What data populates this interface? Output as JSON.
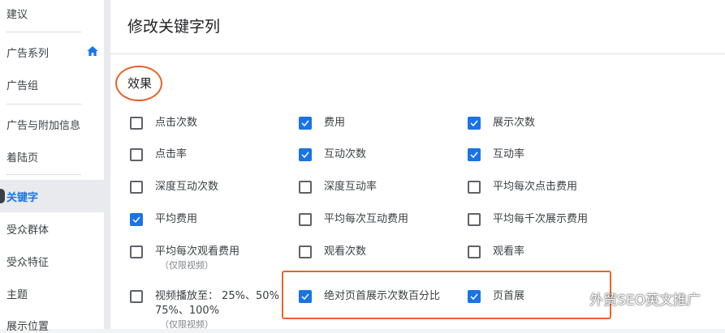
{
  "sidebar": {
    "items": [
      {
        "label": "建议"
      },
      {
        "label": "广告系列"
      },
      {
        "label": "广告组"
      },
      {
        "label": "广告与附加信息"
      },
      {
        "label": "着陆页"
      },
      {
        "label": "关键字"
      },
      {
        "label": "受众群体"
      },
      {
        "label": "受众特征"
      },
      {
        "label": "主题"
      },
      {
        "label": "展示位置"
      }
    ],
    "active": "关键字"
  },
  "panel": {
    "title": "修改关键字列",
    "section_title": "效果"
  },
  "options": [
    {
      "label": "点击次数",
      "checked": false
    },
    {
      "label": "费用",
      "checked": true
    },
    {
      "label": "展示次数",
      "checked": true
    },
    {
      "label": "点击率",
      "checked": false
    },
    {
      "label": "互动次数",
      "checked": true
    },
    {
      "label": "互动率",
      "checked": true
    },
    {
      "label": "深度互动次数",
      "checked": false
    },
    {
      "label": "深度互动率",
      "checked": false
    },
    {
      "label": "平均每次点击费用",
      "checked": false
    },
    {
      "label": "平均费用",
      "checked": true
    },
    {
      "label": "平均每次互动费用",
      "checked": false
    },
    {
      "label": "平均每千次展示费用",
      "checked": false
    },
    {
      "label": "平均每次观看费用",
      "sub": "（仅限视频）",
      "checked": false
    },
    {
      "label": "观看次数",
      "checked": false
    },
    {
      "label": "观看率",
      "checked": false
    },
    {
      "label": "视频播放至： 25%、50%",
      "label2": "75%、100%",
      "sub": "（仅限视频）",
      "checked": false
    },
    {
      "label": "绝对页首展示次数百分比",
      "checked": true
    },
    {
      "label": "页首展",
      "checked": true
    }
  ],
  "watermark": {
    "text": "外贸SEO英文推广",
    "icon": "wechat-icon"
  },
  "colors": {
    "accent": "#1a73e8",
    "annotation": "#e8642a"
  }
}
